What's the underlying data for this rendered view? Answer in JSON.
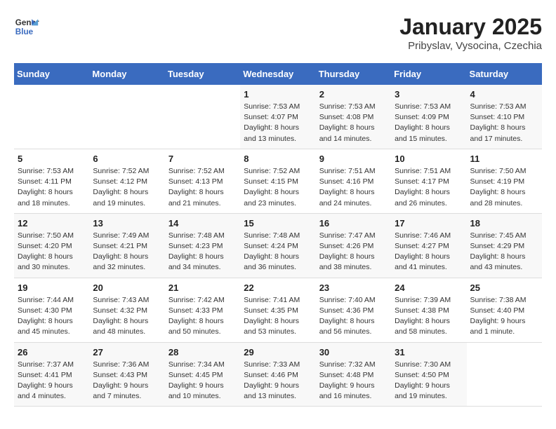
{
  "logo": {
    "general": "General",
    "blue": "Blue"
  },
  "title": "January 2025",
  "subtitle": "Pribyslav, Vysocina, Czechia",
  "days_of_week": [
    "Sunday",
    "Monday",
    "Tuesday",
    "Wednesday",
    "Thursday",
    "Friday",
    "Saturday"
  ],
  "weeks": [
    [
      {
        "day": "",
        "info": ""
      },
      {
        "day": "",
        "info": ""
      },
      {
        "day": "",
        "info": ""
      },
      {
        "day": "1",
        "info": "Sunrise: 7:53 AM\nSunset: 4:07 PM\nDaylight: 8 hours\nand 13 minutes."
      },
      {
        "day": "2",
        "info": "Sunrise: 7:53 AM\nSunset: 4:08 PM\nDaylight: 8 hours\nand 14 minutes."
      },
      {
        "day": "3",
        "info": "Sunrise: 7:53 AM\nSunset: 4:09 PM\nDaylight: 8 hours\nand 15 minutes."
      },
      {
        "day": "4",
        "info": "Sunrise: 7:53 AM\nSunset: 4:10 PM\nDaylight: 8 hours\nand 17 minutes."
      }
    ],
    [
      {
        "day": "5",
        "info": "Sunrise: 7:53 AM\nSunset: 4:11 PM\nDaylight: 8 hours\nand 18 minutes."
      },
      {
        "day": "6",
        "info": "Sunrise: 7:52 AM\nSunset: 4:12 PM\nDaylight: 8 hours\nand 19 minutes."
      },
      {
        "day": "7",
        "info": "Sunrise: 7:52 AM\nSunset: 4:13 PM\nDaylight: 8 hours\nand 21 minutes."
      },
      {
        "day": "8",
        "info": "Sunrise: 7:52 AM\nSunset: 4:15 PM\nDaylight: 8 hours\nand 23 minutes."
      },
      {
        "day": "9",
        "info": "Sunrise: 7:51 AM\nSunset: 4:16 PM\nDaylight: 8 hours\nand 24 minutes."
      },
      {
        "day": "10",
        "info": "Sunrise: 7:51 AM\nSunset: 4:17 PM\nDaylight: 8 hours\nand 26 minutes."
      },
      {
        "day": "11",
        "info": "Sunrise: 7:50 AM\nSunset: 4:19 PM\nDaylight: 8 hours\nand 28 minutes."
      }
    ],
    [
      {
        "day": "12",
        "info": "Sunrise: 7:50 AM\nSunset: 4:20 PM\nDaylight: 8 hours\nand 30 minutes."
      },
      {
        "day": "13",
        "info": "Sunrise: 7:49 AM\nSunset: 4:21 PM\nDaylight: 8 hours\nand 32 minutes."
      },
      {
        "day": "14",
        "info": "Sunrise: 7:48 AM\nSunset: 4:23 PM\nDaylight: 8 hours\nand 34 minutes."
      },
      {
        "day": "15",
        "info": "Sunrise: 7:48 AM\nSunset: 4:24 PM\nDaylight: 8 hours\nand 36 minutes."
      },
      {
        "day": "16",
        "info": "Sunrise: 7:47 AM\nSunset: 4:26 PM\nDaylight: 8 hours\nand 38 minutes."
      },
      {
        "day": "17",
        "info": "Sunrise: 7:46 AM\nSunset: 4:27 PM\nDaylight: 8 hours\nand 41 minutes."
      },
      {
        "day": "18",
        "info": "Sunrise: 7:45 AM\nSunset: 4:29 PM\nDaylight: 8 hours\nand 43 minutes."
      }
    ],
    [
      {
        "day": "19",
        "info": "Sunrise: 7:44 AM\nSunset: 4:30 PM\nDaylight: 8 hours\nand 45 minutes."
      },
      {
        "day": "20",
        "info": "Sunrise: 7:43 AM\nSunset: 4:32 PM\nDaylight: 8 hours\nand 48 minutes."
      },
      {
        "day": "21",
        "info": "Sunrise: 7:42 AM\nSunset: 4:33 PM\nDaylight: 8 hours\nand 50 minutes."
      },
      {
        "day": "22",
        "info": "Sunrise: 7:41 AM\nSunset: 4:35 PM\nDaylight: 8 hours\nand 53 minutes."
      },
      {
        "day": "23",
        "info": "Sunrise: 7:40 AM\nSunset: 4:36 PM\nDaylight: 8 hours\nand 56 minutes."
      },
      {
        "day": "24",
        "info": "Sunrise: 7:39 AM\nSunset: 4:38 PM\nDaylight: 8 hours\nand 58 minutes."
      },
      {
        "day": "25",
        "info": "Sunrise: 7:38 AM\nSunset: 4:40 PM\nDaylight: 9 hours\nand 1 minute."
      }
    ],
    [
      {
        "day": "26",
        "info": "Sunrise: 7:37 AM\nSunset: 4:41 PM\nDaylight: 9 hours\nand 4 minutes."
      },
      {
        "day": "27",
        "info": "Sunrise: 7:36 AM\nSunset: 4:43 PM\nDaylight: 9 hours\nand 7 minutes."
      },
      {
        "day": "28",
        "info": "Sunrise: 7:34 AM\nSunset: 4:45 PM\nDaylight: 9 hours\nand 10 minutes."
      },
      {
        "day": "29",
        "info": "Sunrise: 7:33 AM\nSunset: 4:46 PM\nDaylight: 9 hours\nand 13 minutes."
      },
      {
        "day": "30",
        "info": "Sunrise: 7:32 AM\nSunset: 4:48 PM\nDaylight: 9 hours\nand 16 minutes."
      },
      {
        "day": "31",
        "info": "Sunrise: 7:30 AM\nSunset: 4:50 PM\nDaylight: 9 hours\nand 19 minutes."
      },
      {
        "day": "",
        "info": ""
      }
    ]
  ]
}
